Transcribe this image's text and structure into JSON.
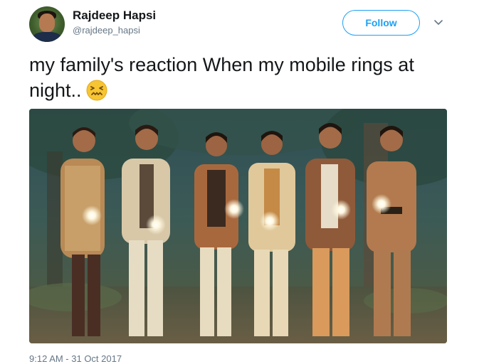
{
  "user": {
    "display_name": "Rajdeep Hapsi",
    "handle": "@rajdeep_hapsi",
    "avatar_icon": "user-avatar"
  },
  "actions": {
    "follow_label": "Follow",
    "more_icon": "chevron-down-icon"
  },
  "tweet": {
    "text": "my family's reaction When my mobile rings at night..",
    "emoji": "confounded-face",
    "timestamp": "9:12 AM - 31 Oct 2017"
  },
  "media": {
    "alt_kind": "photo",
    "description_icon": "group-with-glowing-lights-photo"
  },
  "colors": {
    "accent": "#1da1f2",
    "text": "#14171a",
    "secondary": "#657786"
  }
}
